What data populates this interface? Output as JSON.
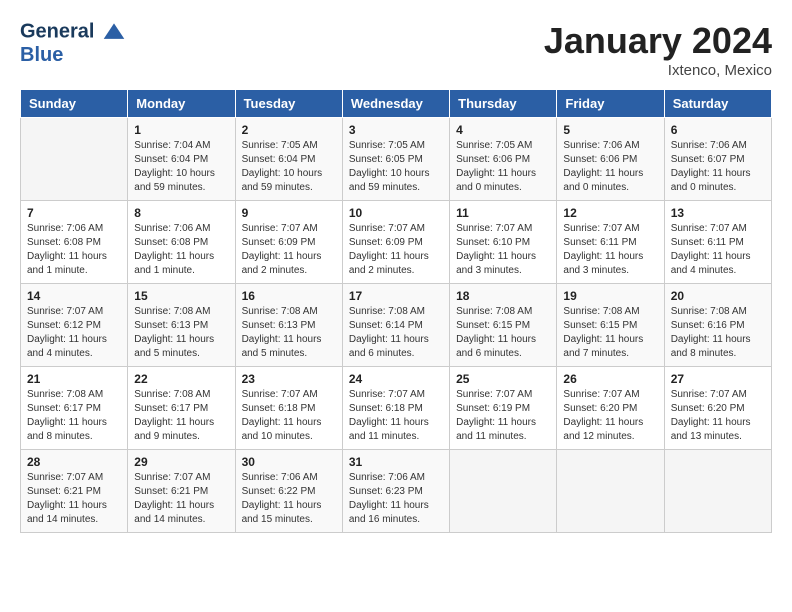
{
  "header": {
    "logo_line1": "General",
    "logo_line2": "Blue",
    "month_title": "January 2024",
    "location": "Ixtenco, Mexico"
  },
  "weekdays": [
    "Sunday",
    "Monday",
    "Tuesday",
    "Wednesday",
    "Thursday",
    "Friday",
    "Saturday"
  ],
  "weeks": [
    [
      {
        "day": "",
        "sunrise": "",
        "sunset": "",
        "daylight": ""
      },
      {
        "day": "1",
        "sunrise": "Sunrise: 7:04 AM",
        "sunset": "Sunset: 6:04 PM",
        "daylight": "Daylight: 10 hours and 59 minutes."
      },
      {
        "day": "2",
        "sunrise": "Sunrise: 7:05 AM",
        "sunset": "Sunset: 6:04 PM",
        "daylight": "Daylight: 10 hours and 59 minutes."
      },
      {
        "day": "3",
        "sunrise": "Sunrise: 7:05 AM",
        "sunset": "Sunset: 6:05 PM",
        "daylight": "Daylight: 10 hours and 59 minutes."
      },
      {
        "day": "4",
        "sunrise": "Sunrise: 7:05 AM",
        "sunset": "Sunset: 6:06 PM",
        "daylight": "Daylight: 11 hours and 0 minutes."
      },
      {
        "day": "5",
        "sunrise": "Sunrise: 7:06 AM",
        "sunset": "Sunset: 6:06 PM",
        "daylight": "Daylight: 11 hours and 0 minutes."
      },
      {
        "day": "6",
        "sunrise": "Sunrise: 7:06 AM",
        "sunset": "Sunset: 6:07 PM",
        "daylight": "Daylight: 11 hours and 0 minutes."
      }
    ],
    [
      {
        "day": "7",
        "sunrise": "Sunrise: 7:06 AM",
        "sunset": "Sunset: 6:08 PM",
        "daylight": "Daylight: 11 hours and 1 minute."
      },
      {
        "day": "8",
        "sunrise": "Sunrise: 7:06 AM",
        "sunset": "Sunset: 6:08 PM",
        "daylight": "Daylight: 11 hours and 1 minute."
      },
      {
        "day": "9",
        "sunrise": "Sunrise: 7:07 AM",
        "sunset": "Sunset: 6:09 PM",
        "daylight": "Daylight: 11 hours and 2 minutes."
      },
      {
        "day": "10",
        "sunrise": "Sunrise: 7:07 AM",
        "sunset": "Sunset: 6:09 PM",
        "daylight": "Daylight: 11 hours and 2 minutes."
      },
      {
        "day": "11",
        "sunrise": "Sunrise: 7:07 AM",
        "sunset": "Sunset: 6:10 PM",
        "daylight": "Daylight: 11 hours and 3 minutes."
      },
      {
        "day": "12",
        "sunrise": "Sunrise: 7:07 AM",
        "sunset": "Sunset: 6:11 PM",
        "daylight": "Daylight: 11 hours and 3 minutes."
      },
      {
        "day": "13",
        "sunrise": "Sunrise: 7:07 AM",
        "sunset": "Sunset: 6:11 PM",
        "daylight": "Daylight: 11 hours and 4 minutes."
      }
    ],
    [
      {
        "day": "14",
        "sunrise": "Sunrise: 7:07 AM",
        "sunset": "Sunset: 6:12 PM",
        "daylight": "Daylight: 11 hours and 4 minutes."
      },
      {
        "day": "15",
        "sunrise": "Sunrise: 7:08 AM",
        "sunset": "Sunset: 6:13 PM",
        "daylight": "Daylight: 11 hours and 5 minutes."
      },
      {
        "day": "16",
        "sunrise": "Sunrise: 7:08 AM",
        "sunset": "Sunset: 6:13 PM",
        "daylight": "Daylight: 11 hours and 5 minutes."
      },
      {
        "day": "17",
        "sunrise": "Sunrise: 7:08 AM",
        "sunset": "Sunset: 6:14 PM",
        "daylight": "Daylight: 11 hours and 6 minutes."
      },
      {
        "day": "18",
        "sunrise": "Sunrise: 7:08 AM",
        "sunset": "Sunset: 6:15 PM",
        "daylight": "Daylight: 11 hours and 6 minutes."
      },
      {
        "day": "19",
        "sunrise": "Sunrise: 7:08 AM",
        "sunset": "Sunset: 6:15 PM",
        "daylight": "Daylight: 11 hours and 7 minutes."
      },
      {
        "day": "20",
        "sunrise": "Sunrise: 7:08 AM",
        "sunset": "Sunset: 6:16 PM",
        "daylight": "Daylight: 11 hours and 8 minutes."
      }
    ],
    [
      {
        "day": "21",
        "sunrise": "Sunrise: 7:08 AM",
        "sunset": "Sunset: 6:17 PM",
        "daylight": "Daylight: 11 hours and 8 minutes."
      },
      {
        "day": "22",
        "sunrise": "Sunrise: 7:08 AM",
        "sunset": "Sunset: 6:17 PM",
        "daylight": "Daylight: 11 hours and 9 minutes."
      },
      {
        "day": "23",
        "sunrise": "Sunrise: 7:07 AM",
        "sunset": "Sunset: 6:18 PM",
        "daylight": "Daylight: 11 hours and 10 minutes."
      },
      {
        "day": "24",
        "sunrise": "Sunrise: 7:07 AM",
        "sunset": "Sunset: 6:18 PM",
        "daylight": "Daylight: 11 hours and 11 minutes."
      },
      {
        "day": "25",
        "sunrise": "Sunrise: 7:07 AM",
        "sunset": "Sunset: 6:19 PM",
        "daylight": "Daylight: 11 hours and 11 minutes."
      },
      {
        "day": "26",
        "sunrise": "Sunrise: 7:07 AM",
        "sunset": "Sunset: 6:20 PM",
        "daylight": "Daylight: 11 hours and 12 minutes."
      },
      {
        "day": "27",
        "sunrise": "Sunrise: 7:07 AM",
        "sunset": "Sunset: 6:20 PM",
        "daylight": "Daylight: 11 hours and 13 minutes."
      }
    ],
    [
      {
        "day": "28",
        "sunrise": "Sunrise: 7:07 AM",
        "sunset": "Sunset: 6:21 PM",
        "daylight": "Daylight: 11 hours and 14 minutes."
      },
      {
        "day": "29",
        "sunrise": "Sunrise: 7:07 AM",
        "sunset": "Sunset: 6:21 PM",
        "daylight": "Daylight: 11 hours and 14 minutes."
      },
      {
        "day": "30",
        "sunrise": "Sunrise: 7:06 AM",
        "sunset": "Sunset: 6:22 PM",
        "daylight": "Daylight: 11 hours and 15 minutes."
      },
      {
        "day": "31",
        "sunrise": "Sunrise: 7:06 AM",
        "sunset": "Sunset: 6:23 PM",
        "daylight": "Daylight: 11 hours and 16 minutes."
      },
      {
        "day": "",
        "sunrise": "",
        "sunset": "",
        "daylight": ""
      },
      {
        "day": "",
        "sunrise": "",
        "sunset": "",
        "daylight": ""
      },
      {
        "day": "",
        "sunrise": "",
        "sunset": "",
        "daylight": ""
      }
    ]
  ]
}
